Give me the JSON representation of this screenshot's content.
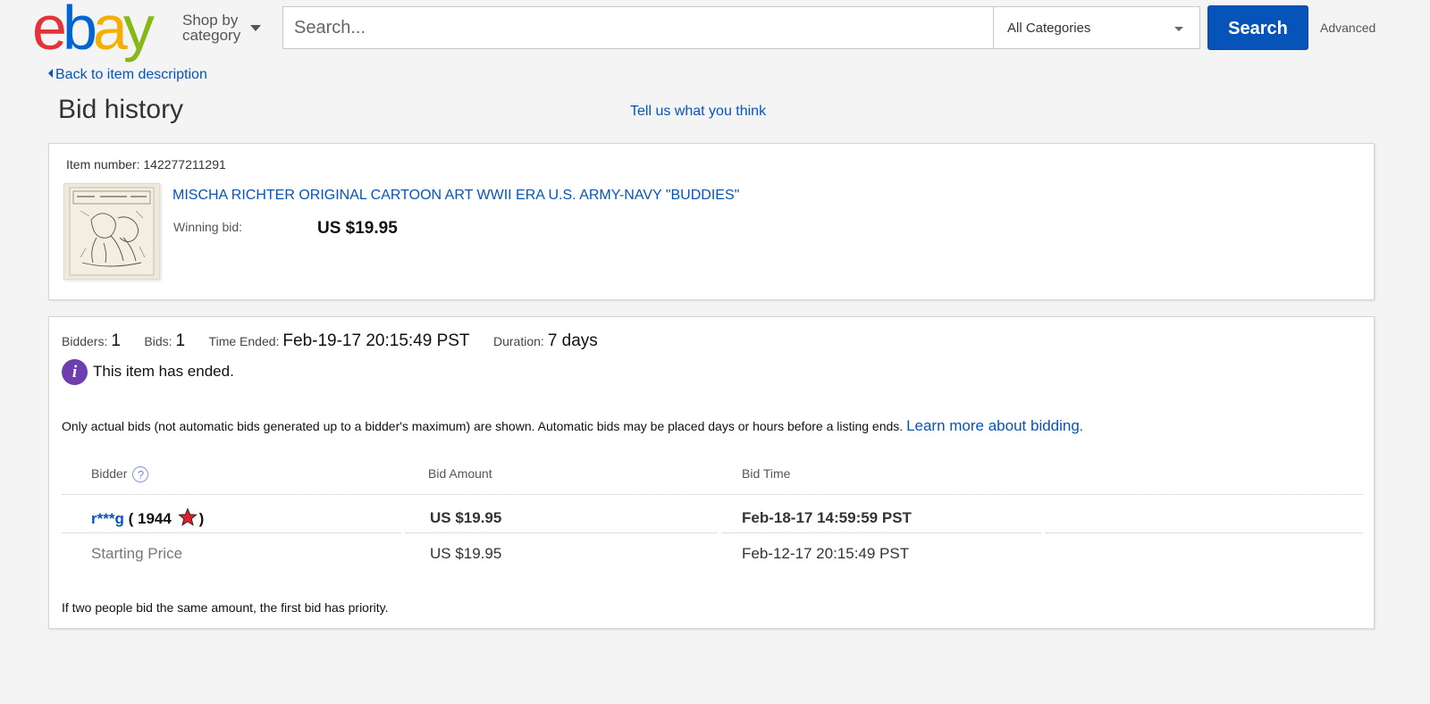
{
  "header": {
    "logo": [
      "e",
      "b",
      "a",
      "y"
    ],
    "logo_colors": [
      "#e53238",
      "#0064d2",
      "#f5af02",
      "#86b817"
    ],
    "shop_by_category": [
      "Shop by",
      "category"
    ],
    "search_placeholder": "Search...",
    "category_select": "All Categories",
    "search_button": "Search",
    "advanced": "Advanced"
  },
  "nav": {
    "back_link": "Back to item description",
    "page_title": "Bid history",
    "feedback_link": "Tell us what you think"
  },
  "item": {
    "item_number_label": "Item number:",
    "item_number": "142277211291",
    "title": "MISCHA RICHTER ORIGINAL CARTOON ART WWII ERA U.S. ARMY-NAVY \"BUDDIES\"",
    "winning_bid_label": "Winning bid:",
    "winning_bid": "US $19.95"
  },
  "summary": {
    "bidders_label": "Bidders:",
    "bidders": "1",
    "bids_label": "Bids:",
    "bids": "1",
    "time_ended_label": "Time Ended:",
    "time_ended": "Feb-19-17 20:15:49 PST",
    "duration_label": "Duration:",
    "duration": "7 days",
    "ended_message": "This item has ended.",
    "note": "Only actual bids (not automatic bids generated up to a bidder's maximum) are shown. Automatic bids may be placed days or hours before a listing ends.",
    "learn_more": "Learn more about bidding",
    "note_end": "."
  },
  "table": {
    "headers": {
      "bidder": "Bidder",
      "help": "?",
      "amount": "Bid Amount",
      "time": "Bid Time"
    },
    "rows": [
      {
        "bidder": "r***g",
        "feedback_open": "(",
        "feedback": "1944",
        "feedback_close": ")",
        "amount": "US $19.95",
        "time": "Feb-18-17 14:59:59 PST"
      },
      {
        "bidder": "Starting Price",
        "amount": "US $19.95",
        "time": "Feb-12-17 20:15:49 PST"
      }
    ],
    "star_color": "#e0202a"
  },
  "footnote": "If two people bid the same amount, the first bid has priority."
}
